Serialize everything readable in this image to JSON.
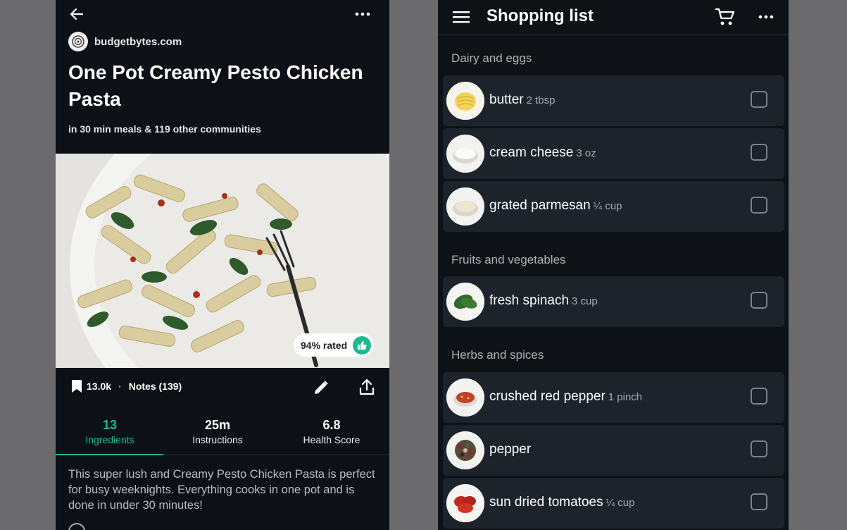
{
  "recipe": {
    "source_name": "budgetbytes.com",
    "title": "One Pot Creamy Pesto Chicken Pasta",
    "communities": "in 30 min meals & 119 other communities",
    "rating_label": "94% rated",
    "saves": "13.0k",
    "separator": "·",
    "notes": "Notes (139)",
    "tabs": [
      {
        "value": "13",
        "label": "Ingredients"
      },
      {
        "value": "25m",
        "label": "Instructions"
      },
      {
        "value": "6.8",
        "label": "Health Score"
      }
    ],
    "description": "This super lush and Creamy Pesto Chicken Pasta is perfect for busy weeknights. Everything cooks in one pot and is done in under 30 minutes!"
  },
  "shopping": {
    "title": "Shopping list",
    "sections": [
      {
        "name": "Dairy and eggs"
      },
      {
        "name": "Fruits and vegetables"
      },
      {
        "name": "Herbs and spices"
      }
    ],
    "items": [
      {
        "name": "butter",
        "qty": "2  tbsp"
      },
      {
        "name": "cream cheese",
        "qty": "3 oz"
      },
      {
        "name": "grated parmesan",
        "qty": "¼ cup"
      },
      {
        "name": "fresh spinach",
        "qty": "3  cup"
      },
      {
        "name": "crushed red pepper",
        "qty": "1 pinch"
      },
      {
        "name": "pepper",
        "qty": ""
      },
      {
        "name": "sun dried tomatoes",
        "qty": "¼ cup"
      }
    ]
  },
  "icons": {
    "back": "arrow-left-icon",
    "more": "more-horizontal-icon",
    "bookmark": "bookmark-icon",
    "edit": "pencil-icon",
    "share": "share-icon",
    "thumbs_up": "thumbs-up-icon",
    "menu": "hamburger-icon",
    "cart": "cart-icon"
  },
  "colors": {
    "accent": "#1fb98f",
    "background": "#0d1117",
    "card": "#1d232b"
  }
}
